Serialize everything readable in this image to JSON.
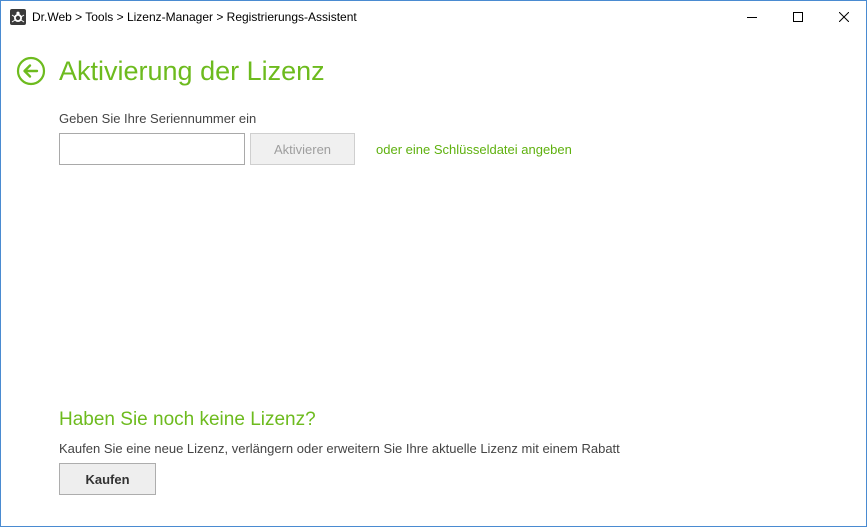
{
  "window": {
    "breadcrumb": "Dr.Web > Tools > Lizenz-Manager > Registrierungs-Assistent",
    "icons": {
      "app": "drweb-spider-icon",
      "minimize": "minimize-icon",
      "maximize": "maximize-icon",
      "close": "close-icon"
    }
  },
  "page": {
    "title": "Aktivierung der Lizenz",
    "back_icon": "back-arrow-circle-icon",
    "serial_label": "Geben Sie Ihre Seriennummer ein",
    "serial_value": "",
    "serial_placeholder": "",
    "activate_label": "Aktivieren",
    "keyfile_link": "oder eine Schlüsseldatei angeben"
  },
  "no_license": {
    "title": "Haben Sie noch keine Lizenz?",
    "description": "Kaufen Sie eine neue Lizenz, verlängern oder erweitern Sie Ihre aktuelle Lizenz mit einem Rabatt",
    "buy_label": "Kaufen"
  },
  "colors": {
    "accent_green": "#6dbb1e",
    "window_border": "#4a8bd1"
  }
}
